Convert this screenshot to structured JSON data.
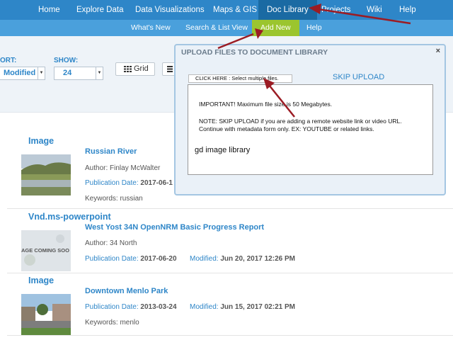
{
  "top_nav": [
    {
      "label": "Home",
      "active": false
    },
    {
      "label": "Explore Data",
      "active": false
    },
    {
      "label": "Data Visualizations",
      "active": false
    },
    {
      "label": "Maps & GIS",
      "active": false
    },
    {
      "label": "Doc Library",
      "active": true
    },
    {
      "label": "Projects",
      "active": false
    },
    {
      "label": "Wiki",
      "active": false
    },
    {
      "label": "Help",
      "active": false
    }
  ],
  "sub_nav": [
    {
      "label": "What's New",
      "active": false
    },
    {
      "label": "Search & List View",
      "active": false
    },
    {
      "label": "Add New",
      "active": true
    },
    {
      "label": "Help",
      "active": false
    }
  ],
  "controls": {
    "sort_label": "ORT:",
    "sort_value": "Modified",
    "show_label": "SHOW:",
    "show_value": "24",
    "grid_label": "Grid"
  },
  "results": [
    {
      "type": "Image",
      "title": "Russian River",
      "author_label": "Author:",
      "author": "Finlay McWalter",
      "pubdate_label": "Publication Date:",
      "pubdate": "2017-06-1",
      "keywords_label": "Keywords:",
      "keywords": "russian"
    },
    {
      "type": "Vnd.ms-powerpoint",
      "title": "West Yost 34N OpenNRM Basic Progress Report",
      "author_label": "Author:",
      "author": "34 North",
      "pubdate_label": "Publication Date:",
      "pubdate": "2017-06-20",
      "modified_label": "Modified:",
      "modified": "Jun 20, 2017 12:26 PM",
      "thumb_text": "AGE COMING SOO"
    },
    {
      "type": "Image",
      "title": "Downtown Menlo Park",
      "pubdate_label": "Publication Date:",
      "pubdate": "2013-03-24",
      "modified_label": "Modified:",
      "modified": "Jun 15, 2017 02:21 PM",
      "keywords_label": "Keywords:",
      "keywords": "menlo"
    }
  ],
  "modal": {
    "title": "UPLOAD FILES TO DOCUMENT LIBRARY",
    "close": "×",
    "select_button": "CLICK HERE : Select multiple files.",
    "skip_upload": "SKIP UPLOAD",
    "important": "IMPORTANT! Maximum file size is 50 Megabytes.",
    "note_line1": "NOTE: SKIP UPLOAD if you are adding a remote website link or video URL.",
    "note_line2": "Continue with metadata form only. EX: YOUTUBE or related links.",
    "library": "gd image library"
  },
  "colors": {
    "nav_bg": "#2e86c8",
    "subnav_bg": "#4aa0dc",
    "active_sub": "#9bc52e",
    "arrow": "#9b1c24"
  }
}
